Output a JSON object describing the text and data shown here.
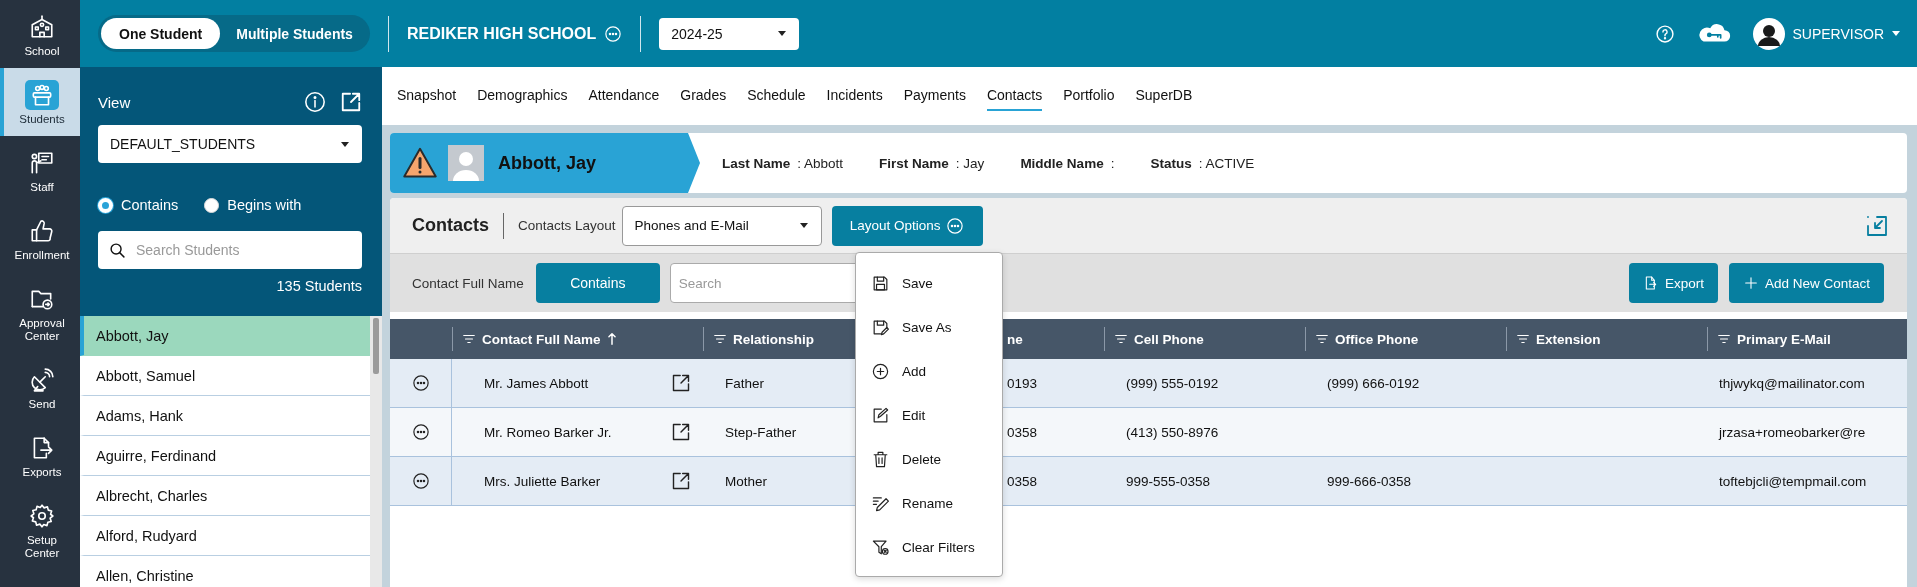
{
  "rail": [
    {
      "label": "School",
      "kind": "school",
      "selected": false
    },
    {
      "label": "Students",
      "kind": "students",
      "selected": true
    },
    {
      "label": "Staff",
      "kind": "staff",
      "selected": false
    },
    {
      "label": "Enrollment",
      "kind": "enrollment",
      "selected": false
    },
    {
      "label": "Approval Center",
      "kind": "approval",
      "selected": false
    },
    {
      "label": "Send",
      "kind": "send",
      "selected": false
    },
    {
      "label": "Exports",
      "kind": "exports",
      "selected": false
    },
    {
      "label": "Setup Center",
      "kind": "setup",
      "selected": false
    }
  ],
  "mode_toggle": [
    {
      "label": "One Student",
      "selected": true
    },
    {
      "label": "Multiple Students",
      "selected": false
    }
  ],
  "school": {
    "name": "REDIKER HIGH SCHOOL"
  },
  "year": {
    "value": "2024-25"
  },
  "user": {
    "name": "SUPERVISOR"
  },
  "view_panel": {
    "title": "View",
    "view": "DEFAULT_STUDENTS",
    "match_options": [
      {
        "label": "Contains",
        "selected": true
      },
      {
        "label": "Begins with",
        "selected": false
      }
    ],
    "search_placeholder": "Search Students",
    "count": "135 Students"
  },
  "students": [
    {
      "name": "Abbott, Jay",
      "selected": true
    },
    {
      "name": "Abbott, Samuel",
      "selected": false
    },
    {
      "name": "Adams, Hank",
      "selected": false
    },
    {
      "name": "Aguirre, Ferdinand",
      "selected": false
    },
    {
      "name": "Albrecht, Charles",
      "selected": false
    },
    {
      "name": "Alford, Rudyard",
      "selected": false
    },
    {
      "name": "Allen, Christine",
      "selected": false
    }
  ],
  "tabs": [
    {
      "label": "Snapshot",
      "selected": false
    },
    {
      "label": "Demographics",
      "selected": false
    },
    {
      "label": "Attendance",
      "selected": false
    },
    {
      "label": "Grades",
      "selected": false
    },
    {
      "label": "Schedule",
      "selected": false
    },
    {
      "label": "Incidents",
      "selected": false
    },
    {
      "label": "Payments",
      "selected": false
    },
    {
      "label": "Contacts",
      "selected": true
    },
    {
      "label": "Portfolio",
      "selected": false
    },
    {
      "label": "SuperDB",
      "selected": false
    }
  ],
  "student_header": {
    "name": "Abbott, Jay",
    "fields": [
      {
        "label": "Last Name",
        "value": ": Abbott"
      },
      {
        "label": "First Name",
        "value": ": Jay"
      },
      {
        "label": "Middle Name",
        "value": ":"
      },
      {
        "label": "Status",
        "value": ": ACTIVE"
      }
    ]
  },
  "contacts": {
    "title": "Contacts",
    "layout_label": "Contacts Layout",
    "layout": "Phones and E-Mail",
    "layout_button": "Layout Options",
    "filter_label": "Contact Full Name",
    "filter_mode": "Contains",
    "search_placeholder": "Search",
    "buttons": [
      {
        "label": "Export",
        "kind": "export"
      },
      {
        "label": "Add New Contact",
        "kind": "add"
      }
    ],
    "table": {
      "columns": [
        {
          "label": "Contact Full Name",
          "kind": "filter",
          "sorted": true
        },
        {
          "label": "Relationship",
          "kind": "filter",
          "sorted": false
        },
        {
          "label": "ne",
          "kind": "covered",
          "sorted": false
        },
        {
          "label": "Cell Phone",
          "kind": "filter",
          "sorted": false
        },
        {
          "label": "Office Phone",
          "kind": "filter",
          "sorted": false
        },
        {
          "label": "Extension",
          "kind": "filter",
          "sorted": false
        },
        {
          "label": "Primary E-Mail",
          "kind": "filter",
          "sorted": false
        }
      ],
      "rows": [
        {
          "name": "Mr. James Abbott",
          "relationship": "Father",
          "home_phone": "0193",
          "cell_phone": "(999) 555-0192",
          "office_phone": "(999) 666-0192",
          "email": "thjwykq@mailinator.com"
        },
        {
          "name": "Mr. Romeo Barker Jr.",
          "relationship": "Step-Father",
          "home_phone": "0358",
          "cell_phone": "(413) 550-8976",
          "email": "jrzasa+romeobarker@re"
        },
        {
          "name": "Mrs. Juliette Barker",
          "relationship": "Mother",
          "home_phone": "0358",
          "cell_phone": "999-555-0358",
          "office_phone": "999-666-0358",
          "email": "toftebjcli@tempmail.com"
        }
      ]
    },
    "layout_menu": [
      {
        "label": "Save",
        "kind": "save"
      },
      {
        "label": "Save As",
        "kind": "save_as"
      },
      {
        "label": "Add",
        "kind": "add"
      },
      {
        "label": "Edit",
        "kind": "edit"
      },
      {
        "label": "Delete",
        "kind": "delete"
      },
      {
        "label": "Rename",
        "kind": "rename"
      },
      {
        "label": "Clear Filters",
        "kind": "clear_filters"
      }
    ]
  }
}
